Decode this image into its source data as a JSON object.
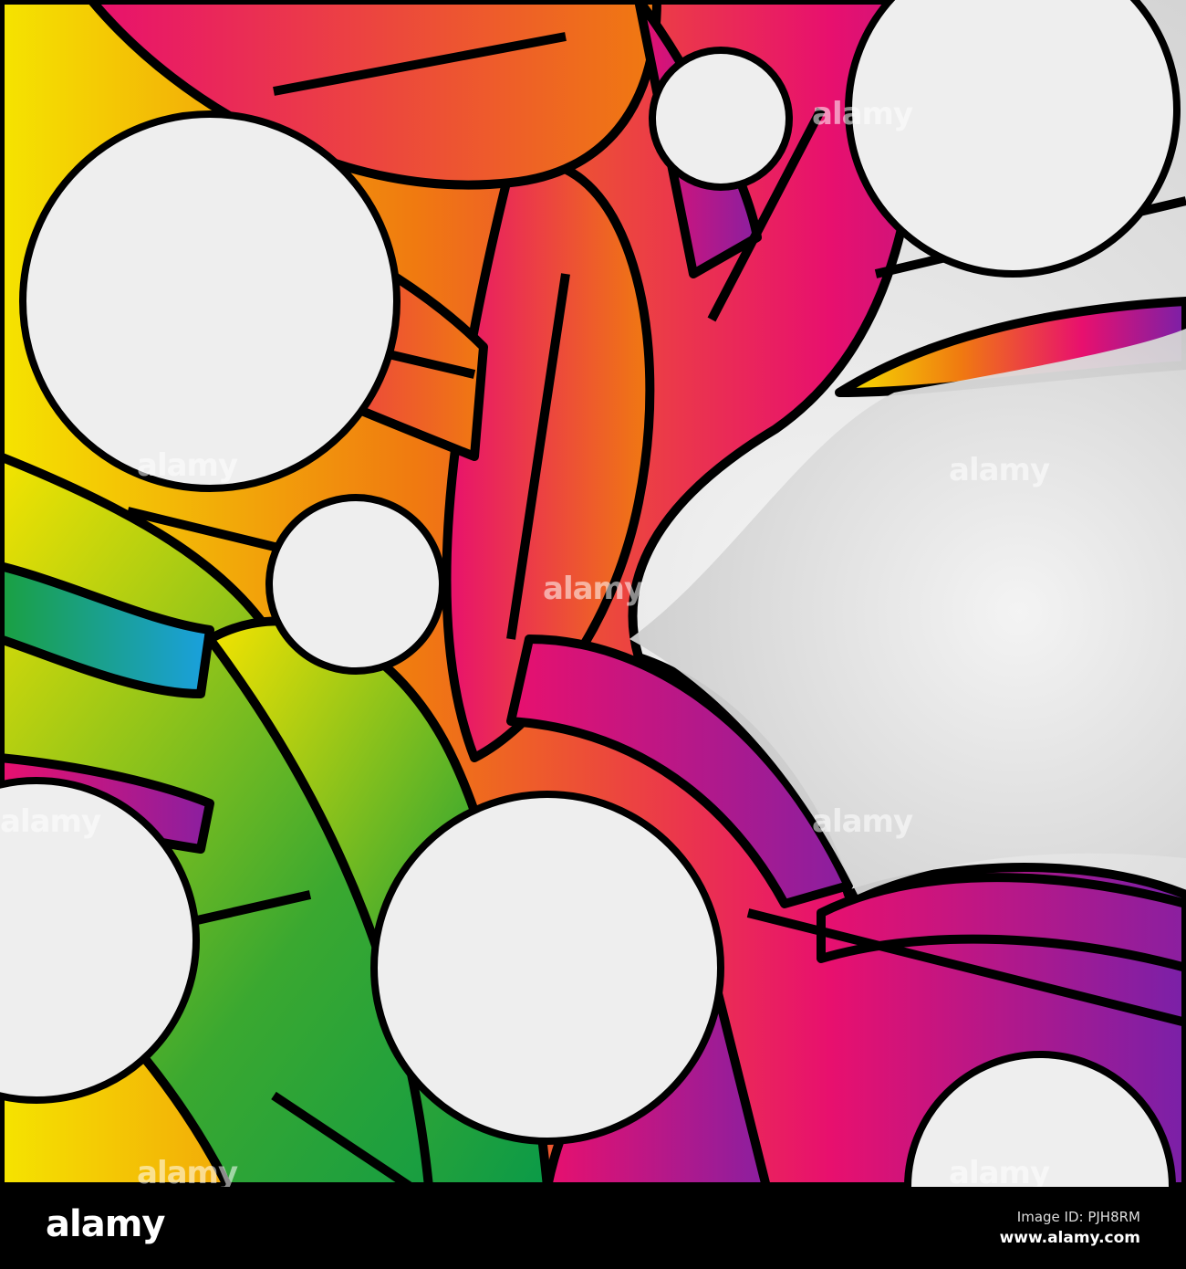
{
  "artwork": {
    "subject": "abstract colorful swirl pattern",
    "palette": [
      "#e8106e",
      "#f06a1c",
      "#f5e400",
      "#1aa040",
      "#8a1fa0",
      "#1aa0e0",
      "#000000",
      "#eeeeee"
    ],
    "watermark_text": "alamy"
  },
  "footer": {
    "logo": "alamy",
    "image_id": "Image ID: PJH8RM",
    "site": "www.alamy.com"
  }
}
